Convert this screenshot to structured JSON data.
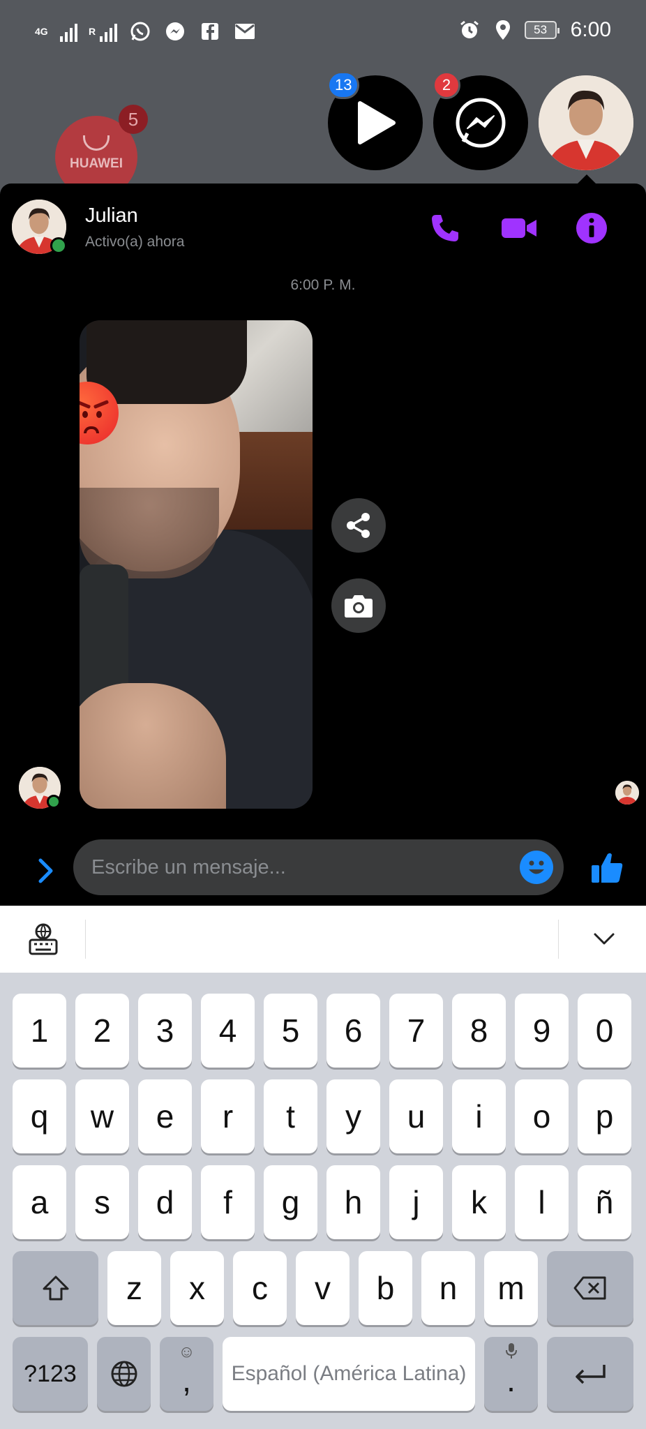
{
  "status_bar": {
    "network": "4G",
    "sim2_badge": "R",
    "time": "6:00",
    "battery": "53",
    "icons": [
      "signal-icon",
      "signal-icon",
      "whatsapp-icon",
      "messenger-icon",
      "facebook-icon",
      "mail-icon",
      "alarm-icon",
      "location-icon",
      "battery-icon"
    ]
  },
  "home": {
    "app_label": "HUAWEI",
    "app_badge": "5"
  },
  "chat_heads": [
    {
      "icon": "play-icon",
      "badge": "13",
      "badge_color": "#1877f2"
    },
    {
      "icon": "messenger-icon",
      "badge": "2",
      "badge_color": "#e0393e"
    },
    {
      "icon": "avatar",
      "badge": ""
    }
  ],
  "chat": {
    "contact_name": "Julian",
    "contact_status": "Activo(a) ahora",
    "accent_color": "#a033ff",
    "timestamp": "6:00 P. M.",
    "header_actions": [
      "phone-icon",
      "video-camera-icon",
      "info-icon"
    ],
    "media_actions": [
      "share-icon",
      "camera-icon"
    ]
  },
  "composer": {
    "placeholder": "Escribe un mensaje...",
    "value": "",
    "accent_color": "#1a8cff"
  },
  "keyboard": {
    "row_numbers": [
      "1",
      "2",
      "3",
      "4",
      "5",
      "6",
      "7",
      "8",
      "9",
      "0"
    ],
    "row_top": [
      "q",
      "w",
      "e",
      "r",
      "t",
      "y",
      "u",
      "i",
      "o",
      "p"
    ],
    "row_middle": [
      "a",
      "s",
      "d",
      "f",
      "g",
      "h",
      "j",
      "k",
      "l",
      "ñ"
    ],
    "row_bottom": [
      "z",
      "x",
      "c",
      "v",
      "b",
      "n",
      "m"
    ],
    "symbols_key": "?123",
    "comma_key": ",",
    "space_label": "Español (América Latina)",
    "period_key": "."
  }
}
